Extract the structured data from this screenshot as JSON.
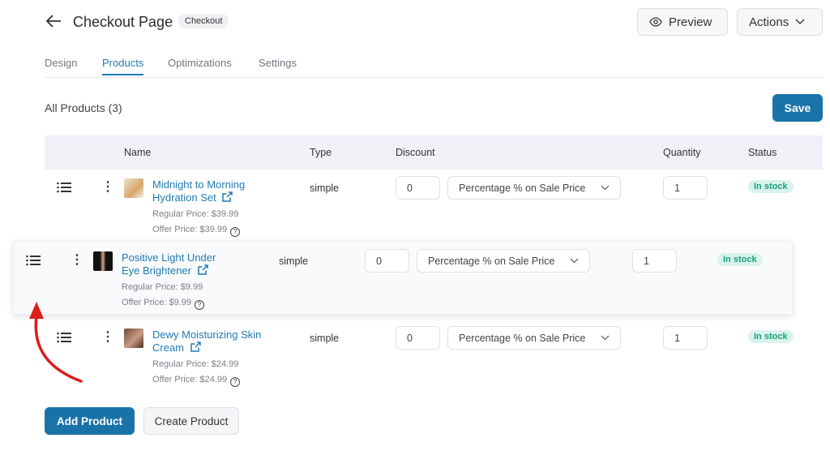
{
  "header": {
    "title": "Checkout Page",
    "badge": "Checkout",
    "preview_label": "Preview",
    "actions_label": "Actions"
  },
  "tabs": [
    {
      "label": "Design"
    },
    {
      "label": "Products",
      "active": true
    },
    {
      "label": "Optimizations"
    },
    {
      "label": "Settings"
    }
  ],
  "section": {
    "title": "All Products (3)",
    "save_label": "Save"
  },
  "table": {
    "columns": [
      "Name",
      "Type",
      "Discount",
      "Quantity",
      "Status"
    ],
    "rows": [
      {
        "name": "Midnight to Morning Hydration Set",
        "regular": "Regular Price: $39.99",
        "offer": "Offer Price: $39.99",
        "type": "simple",
        "discount": "0",
        "discount_type": "Percentage % on Sale Price",
        "quantity": "1",
        "status": "In stock"
      },
      {
        "name": "Positive Light Under Eye Brightener",
        "regular": "Regular Price: $9.99",
        "offer": "Offer Price: $9.99",
        "type": "simple",
        "discount": "0",
        "discount_type": "Percentage % on Sale Price",
        "quantity": "1",
        "status": "In stock",
        "dragging": true
      },
      {
        "name": "Dewy Moisturizing Skin Cream",
        "regular": "Regular Price: $24.99",
        "offer": "Offer Price: $24.99",
        "type": "simple",
        "discount": "0",
        "discount_type": "Percentage % on Sale Price",
        "quantity": "1",
        "status": "In stock"
      }
    ]
  },
  "footer": {
    "add_label": "Add Product",
    "create_label": "Create Product"
  },
  "colors": {
    "accent": "#1a73a8",
    "link": "#1f7bb5",
    "badge_bg": "#d9f3ec",
    "badge_text": "#1ba17a",
    "annotation_arrow": "#e01b1b"
  },
  "icons": {
    "back": "arrow-left-icon",
    "preview": "eye-icon",
    "actions": "chevron-down-icon",
    "drag": "drag-handle-icon",
    "menu": "kebab-icon",
    "external": "external-link-icon",
    "help": "question-circle-icon"
  }
}
